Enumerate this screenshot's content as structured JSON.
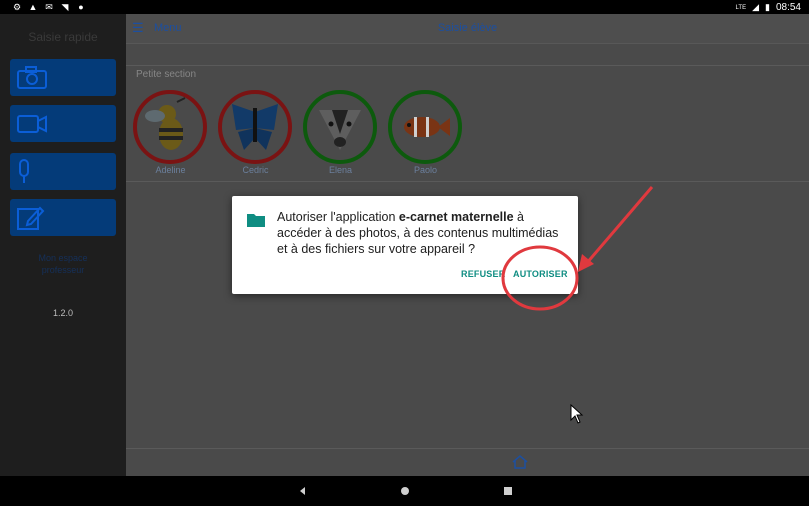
{
  "statusbar": {
    "time": "08:54",
    "signal_label": "LTE",
    "left_icons": [
      "settings-icon",
      "drive-icon",
      "mail-icon",
      "wifi-off-icon",
      "circle-icon"
    ]
  },
  "sidebar": {
    "title": "Saisie rapide",
    "actions": [
      {
        "name": "photo",
        "icon": "camera-icon"
      },
      {
        "name": "video",
        "icon": "video-icon"
      },
      {
        "name": "audio",
        "icon": "microphone-icon"
      },
      {
        "name": "note",
        "icon": "edit-icon"
      }
    ],
    "pro_link_line1": "Mon espace",
    "pro_link_line2": "professeur",
    "version": "1.2.0"
  },
  "header": {
    "menu_label": "Menu",
    "title": "Saisie élève"
  },
  "main": {
    "section_label": "Petite section",
    "students": [
      {
        "name": "Adeline",
        "animal": "wasp",
        "ring": "red"
      },
      {
        "name": "Cedric",
        "animal": "butterfly",
        "ring": "red"
      },
      {
        "name": "Elena",
        "animal": "badger",
        "ring": "green"
      },
      {
        "name": "Paolo",
        "animal": "clownfish",
        "ring": "green"
      }
    ]
  },
  "dialog": {
    "text_before": "Autoriser l'application ",
    "app_name": "e-carnet maternelle",
    "text_after": " à accéder à des photos, à des contenus multimédias et à des fichiers sur votre appareil ?",
    "deny_label": "REFUSER",
    "allow_label": "AUTORISER",
    "icon": "folder-icon"
  },
  "colors": {
    "accent": "#0f8d82",
    "header_text": "#1c4fa0",
    "annotation": "#e0393e",
    "sidebar_button": "#043b79"
  }
}
